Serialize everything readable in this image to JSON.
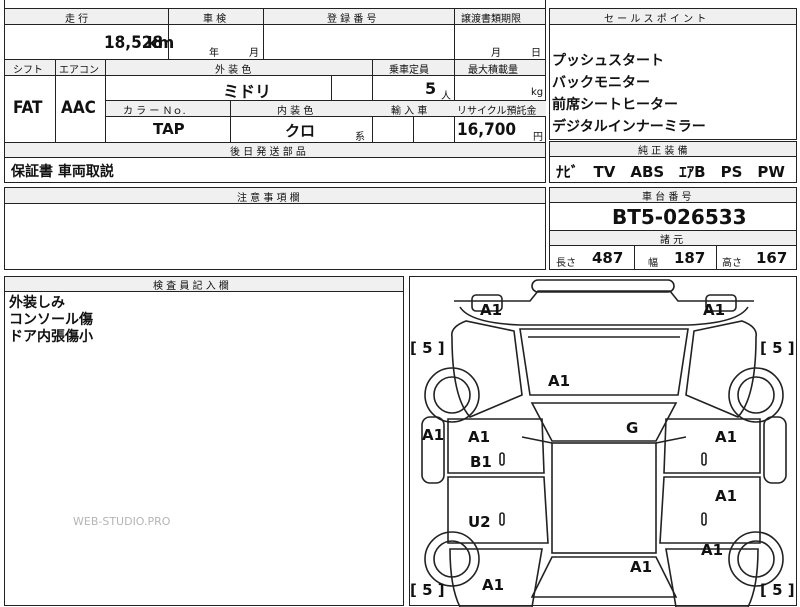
{
  "header_table": {
    "mileage_label": "走 行",
    "mileage_value": "18,528",
    "mileage_unit": "km",
    "inspection_label": "車 検",
    "inspection_year_unit": "年",
    "inspection_month_unit": "月",
    "registration_label": "登 録 番 号",
    "transfer_label": "譲渡書類期限",
    "transfer_month_unit": "月",
    "transfer_day_unit": "日"
  },
  "spec_table": {
    "shift_label": "シフト",
    "shift_value": "FAT",
    "ac_label": "エアコン",
    "ac_value": "AAC",
    "exterior_label": "外 装 色",
    "exterior_value": "ミドリ",
    "capacity_label": "乗車定員",
    "capacity_value": "5",
    "capacity_unit": "人",
    "maxload_label": "最大積載量",
    "maxload_unit": "kg",
    "color_no_label": "カ ラ ー Ｎｏ.",
    "color_no_value": "TAP",
    "interior_label": "内 装 色",
    "interior_value": "クロ",
    "interior_unit": "系",
    "import_label": "輸 入 車",
    "recycle_label": "リサイクル預託金",
    "recycle_value": "16,700",
    "recycle_unit": "円",
    "later_parts_label": "後 日 発 送 部 品",
    "later_parts_value": "保証書 車両取説"
  },
  "sales_points": {
    "title": "セ ー ル ス ポ イ ン ト",
    "items": [
      "プッシュスタート",
      "バックモニター",
      "前席シートヒーター",
      "デジタルインナーミラー"
    ]
  },
  "genuine_equipment": {
    "title": "純 正 装 備",
    "value": "ﾅﾋﾞ　TV　ABS　ｴｱB　PS　PW"
  },
  "caution": {
    "title": "注 意 事 項 欄"
  },
  "chassis": {
    "title": "車 台 番 号",
    "value": "BT5-026533"
  },
  "dimensions": {
    "title": "諸 元",
    "length_label": "長さ",
    "length_value": "487",
    "width_label": "幅",
    "width_value": "187",
    "height_label": "高さ",
    "height_value": "167"
  },
  "inspector_notes": {
    "title": "検 査 員 記 入 欄",
    "lines": [
      "外装しみ",
      "コンソール傷",
      "ドア内張傷小"
    ]
  },
  "car_diagram": {
    "tire_front_left": "[ 5 ]",
    "tire_front_right": "[ 5 ]",
    "tire_rear_left": "[ 5 ]",
    "tire_rear_right": "[ 5 ]",
    "marks": {
      "front_left_corner": "A1",
      "front_right_corner": "A1",
      "hood": "A1",
      "windshield": "G",
      "left_fender": "A1",
      "front_left_door_a": "A1",
      "front_left_door_b": "B1",
      "front_right_door": "A1",
      "rear_right_door": "A1",
      "rear_left_door": "U2",
      "rear_right_fender": "A1",
      "roof_rear": "A1",
      "rear_left_corner": "A1"
    }
  },
  "watermark": "WEB-STUDIO.PRO"
}
